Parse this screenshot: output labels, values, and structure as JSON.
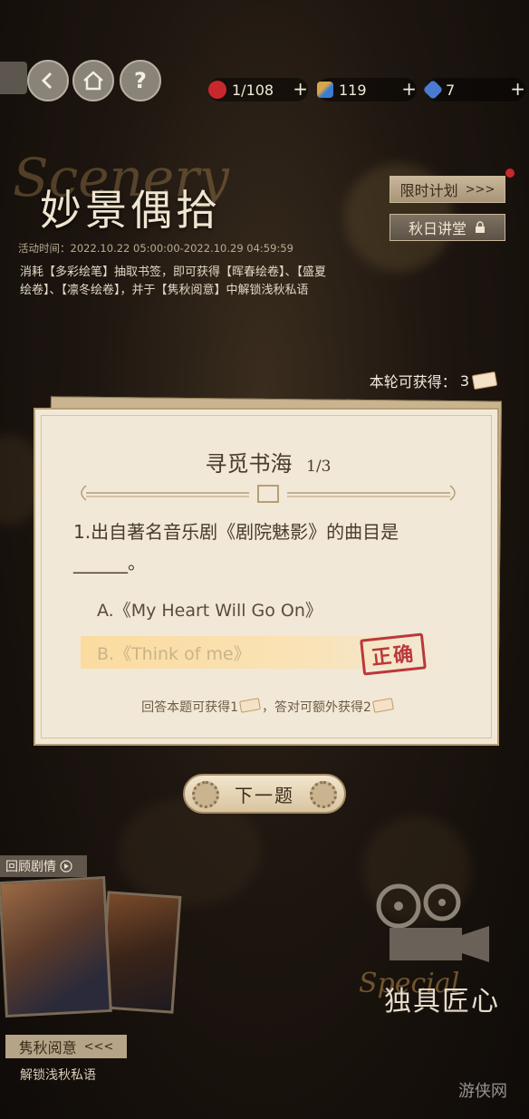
{
  "topbar": {
    "resources": [
      {
        "name": "rose",
        "value": "1/108",
        "color": "#c8282d"
      },
      {
        "name": "brush",
        "value": "119",
        "color": "#d7a64a"
      },
      {
        "name": "gem",
        "value": "7",
        "color": "#4a7bd0"
      }
    ],
    "plus": "+",
    "help": "?"
  },
  "event": {
    "title": "妙景偶拾",
    "script": "Scenery",
    "time": "活动时间：2022.10.22 05:00:00-2022.10.29 04:59:59",
    "description": "消耗【多彩绘笔】抽取书签，即可获得【晖春绘卷】、【盛夏绘卷】、【凛冬绘卷】，并于【隽秋阅意】中解锁浅秋私语"
  },
  "side_buttons": {
    "limited": "限时计划",
    "limited_arrows": ">>>",
    "autumn_hall": "秋日讲堂"
  },
  "round_reward": {
    "label": "本轮可获得：",
    "count": "3"
  },
  "quiz": {
    "title": "寻觅书海",
    "progress": "1/3",
    "question": "1.出自著名音乐剧《剧院魅影》的曲目是______。",
    "options": [
      {
        "label": "A.《My Heart Will Go On》"
      },
      {
        "label": "B.《Think of me》"
      }
    ],
    "correct_stamp": "正确",
    "footer_part1": "回答本题可获得1",
    "footer_part2": "，答对可额外获得2"
  },
  "next_button": "下一题",
  "review": {
    "label": "回顾剧情",
    "icon": "play-icon"
  },
  "autumn": {
    "label": "隽秋阅意",
    "arrows": "<<<",
    "subtitle": "解锁浅秋私语"
  },
  "craft": {
    "title": "独具匠心",
    "script": "Special"
  },
  "watermark": "游侠网"
}
